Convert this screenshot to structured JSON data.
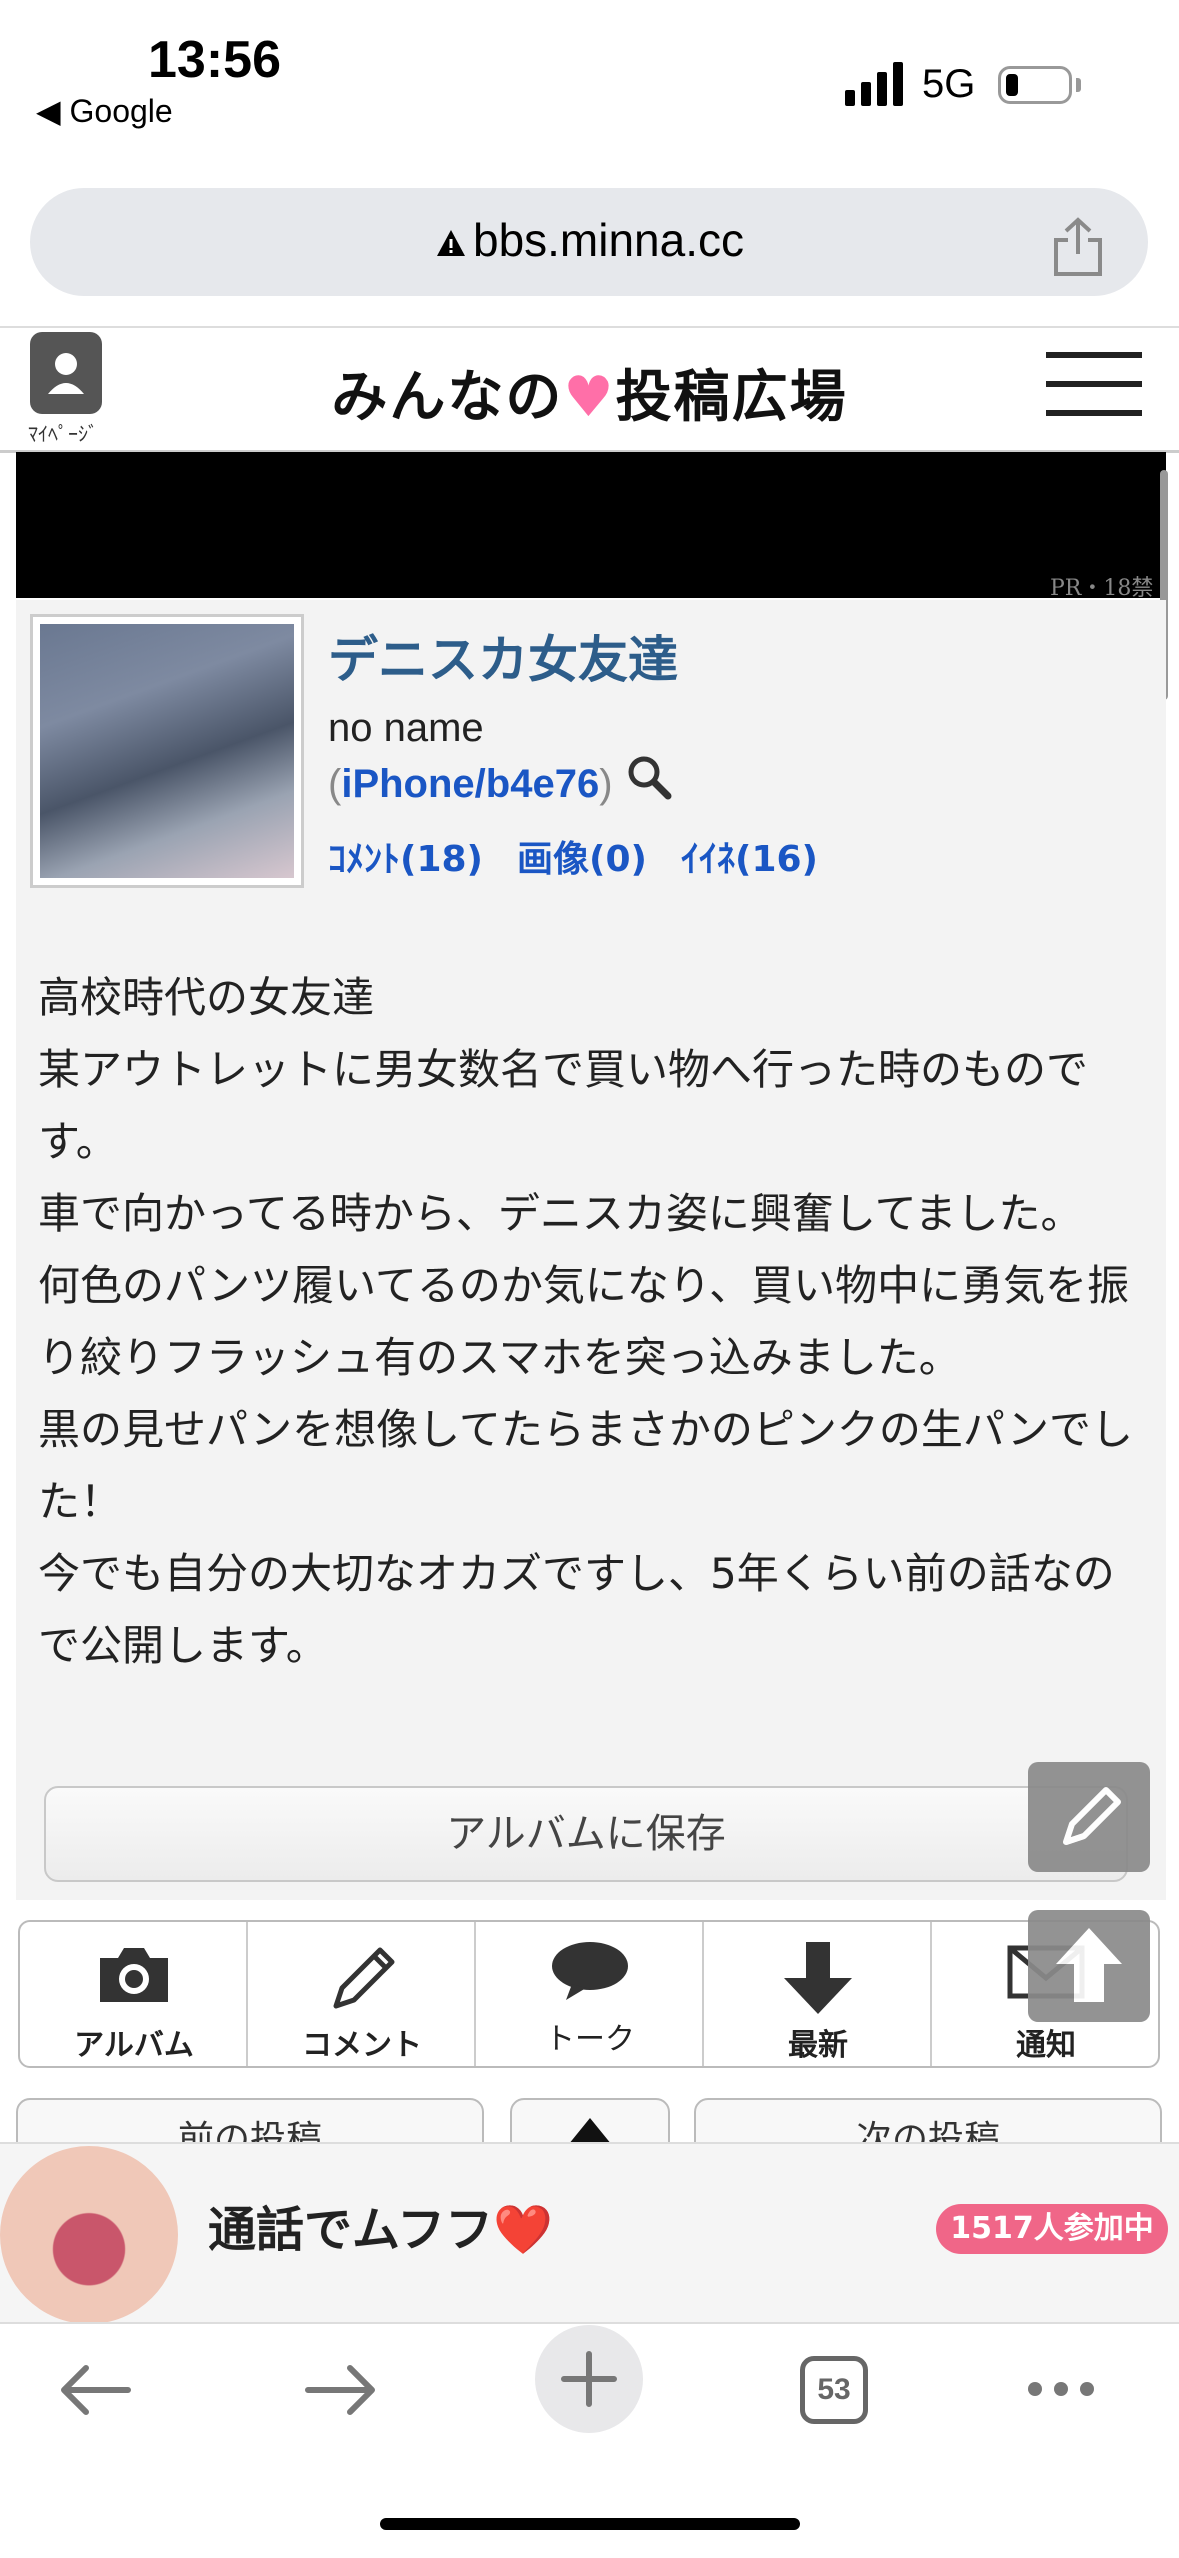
{
  "status_bar": {
    "time": "13:56",
    "back_app": "◀ Google",
    "network": "5G"
  },
  "browser": {
    "url": "bbs.minna.cc",
    "tab_count": "53"
  },
  "site": {
    "mypage_label": "ﾏｲﾍﾟｰｼﾞ",
    "title_left": "みんなの",
    "title_heart": "♥",
    "title_right": "投稿広場"
  },
  "ad_banner": {
    "label": "PR・18禁"
  },
  "post": {
    "title": "デニスカ女友達",
    "author": "no name",
    "device_open": "(",
    "device": "iPhone/b4e76",
    "device_close": ")",
    "stats": {
      "comments": "ｺﾒﾝﾄ(18)",
      "images": "画像(0)",
      "likes": "ｲｲﾈ(16)"
    },
    "body": [
      "高校時代の女友達",
      "某アウトレットに男女数名で買い物へ行った時のものです。",
      "車で向かってる時から、デニスカ姿に興奮してました。",
      "何色のパンツ履いてるのか気になり、買い物中に勇気を振り絞りフラッシュ有のスマホを突っ込みました。",
      "黒の見せパンを想像してたらまさかのピンクの生パンでした！",
      "今でも自分の大切なオカズですし、5年くらい前の話なので公開します。"
    ],
    "save_button": "アルバムに保存"
  },
  "tabs": [
    {
      "label": "アルバム",
      "icon": "camera-icon"
    },
    {
      "label": "コメント",
      "icon": "pencil-icon"
    },
    {
      "label": "トーク",
      "icon": "speech-bubble-icon"
    },
    {
      "label": "最新",
      "icon": "down-arrow-icon"
    },
    {
      "label": "通知",
      "icon": "envelope-icon"
    }
  ],
  "nav": {
    "prev": "前の投稿",
    "next": "次の投稿"
  },
  "bottom_ad": {
    "text": "通話でムフフ❤️",
    "badge": "1517人参加中"
  },
  "colors": {
    "title_blue": "#2d5d8a",
    "link_blue": "#1a56c4",
    "heart_pink": "#ff6fa8",
    "badge_pink": "#f06688"
  }
}
